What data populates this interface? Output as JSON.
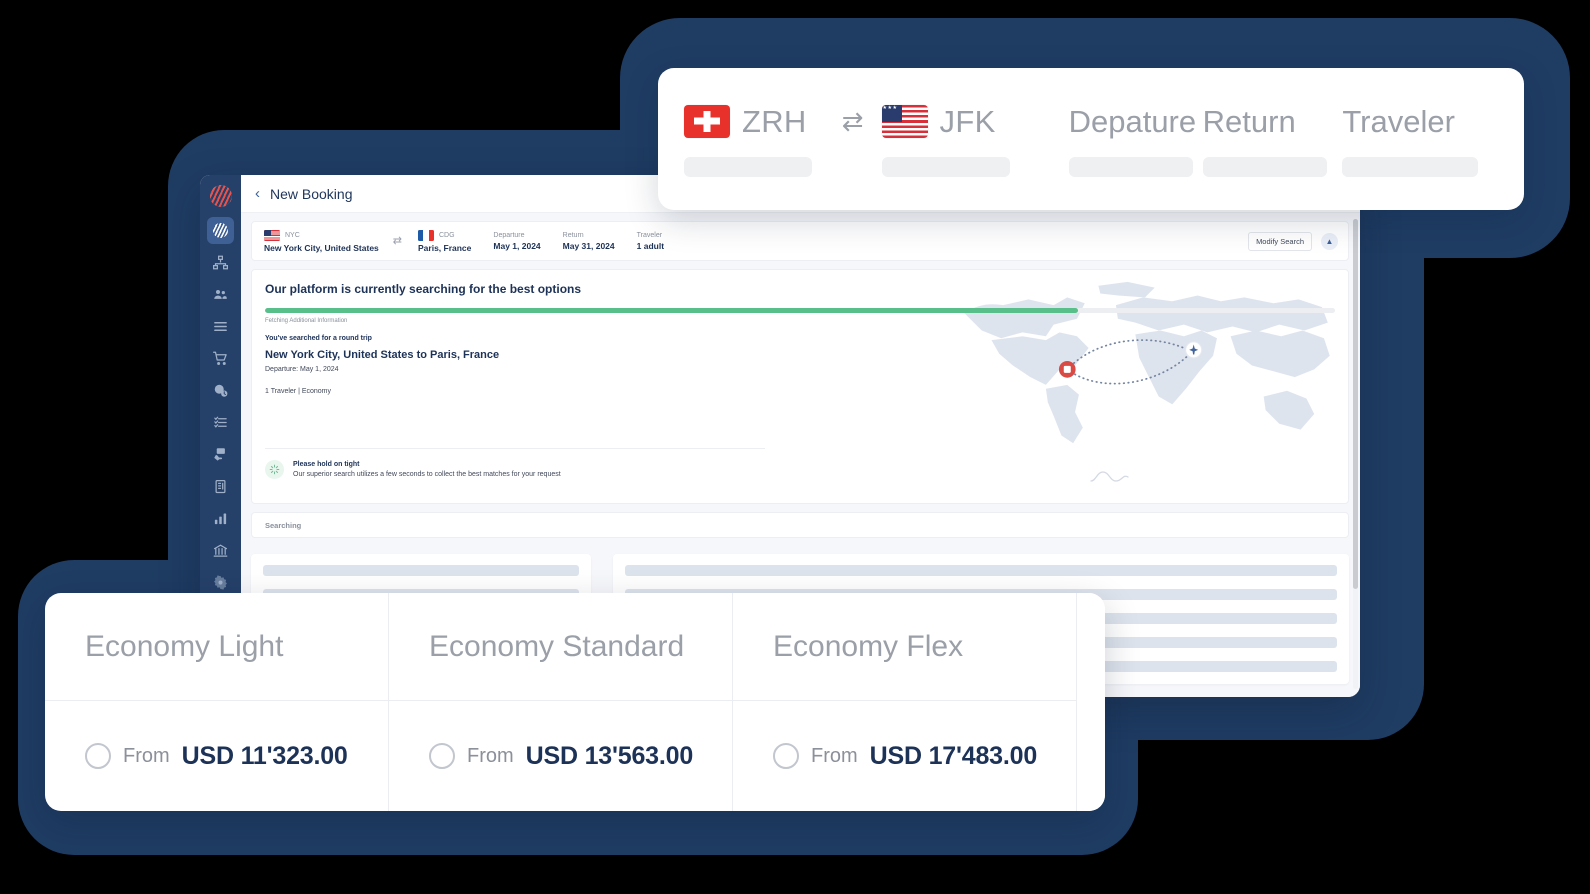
{
  "theme": {
    "navy": "#1f3c63",
    "sidebar_navy": "#254069",
    "accent_blue": "#3c6099",
    "progress_green": "#58bf8a",
    "text_dark": "#1d3257",
    "muted_grey": "#9a9fa8",
    "skeleton_grey": "#dde3ec"
  },
  "topbar": {
    "origin": {
      "code": "ZRH",
      "flag": "swiss-flag"
    },
    "destination": {
      "code": "JFK",
      "flag": "us-flag"
    },
    "swap_icon": "swap-arrows-icon",
    "departure_label": "Depature",
    "return_label": "Return",
    "traveler_label": "Traveler"
  },
  "app": {
    "title": "New Booking",
    "back_icon": "chevron-left-icon",
    "sidebar": {
      "logo": "globe-logo",
      "items": [
        {
          "name": "sidebar-item-globe",
          "icon": "globe-icon",
          "active": true
        },
        {
          "name": "sidebar-item-org",
          "icon": "org-chart-icon",
          "active": false
        },
        {
          "name": "sidebar-item-users",
          "icon": "users-icon",
          "active": false
        },
        {
          "name": "sidebar-item-list",
          "icon": "list-icon",
          "active": false
        },
        {
          "name": "sidebar-item-cart",
          "icon": "shopping-cart-icon",
          "active": false
        },
        {
          "name": "sidebar-item-globe-clock",
          "icon": "globe-clock-icon",
          "active": false
        },
        {
          "name": "sidebar-item-checklist",
          "icon": "checklist-icon",
          "active": false
        },
        {
          "name": "sidebar-item-hand-card",
          "icon": "hand-card-icon",
          "active": false
        },
        {
          "name": "sidebar-item-building",
          "icon": "building-icon",
          "active": false
        },
        {
          "name": "sidebar-item-analytics",
          "icon": "bar-chart-icon",
          "active": false
        },
        {
          "name": "sidebar-item-bank",
          "icon": "bank-icon",
          "active": false
        },
        {
          "name": "sidebar-item-settings",
          "icon": "gear-icon",
          "active": false
        }
      ]
    },
    "summary": {
      "origin_code": "NYC",
      "origin_city": "New York City, United States",
      "origin_flag": "us-flag",
      "swap_icon": "swap-arrows-icon",
      "destination_code": "CDG",
      "destination_city": "Paris, France",
      "destination_flag": "france-flag",
      "departure_label": "Departure",
      "departure_value": "May 1, 2024",
      "return_label": "Return",
      "return_value": "May 31, 2024",
      "traveler_label": "Traveler",
      "traveler_value": "1 adult",
      "modify_button": "Modify Search",
      "collapse_icon": "chevron-up-icon"
    },
    "searching": {
      "heading": "Our platform is currently searching for the best options",
      "progress_percent": 76,
      "progress_caption": "Fetching Additional Information",
      "trip_type": "You've searched for a round trip",
      "route": "New York City, United States to Paris, France",
      "departure": "Departure: May 1, 2024",
      "travelers": "1 Traveler | Economy",
      "hold_title": "Please hold on tight",
      "hold_subtitle": "Our superior search utilizes a few seconds to collect the best matches for your request",
      "spinner_icon": "loading-spinner-icon",
      "status_label": "Searching",
      "map": {
        "origin_marker": "map-pin-marker",
        "plane_icon": "airplane-icon",
        "path": "dotted-flight-path"
      }
    }
  },
  "fares": {
    "options": [
      {
        "name": "Economy Light",
        "from_label": "From",
        "price": "USD 11'323.00",
        "selected": false
      },
      {
        "name": "Economy Standard",
        "from_label": "From",
        "price": "USD 13'563.00",
        "selected": false
      },
      {
        "name": "Economy Flex",
        "from_label": "From",
        "price": "USD 17'483.00",
        "selected": false
      }
    ]
  }
}
